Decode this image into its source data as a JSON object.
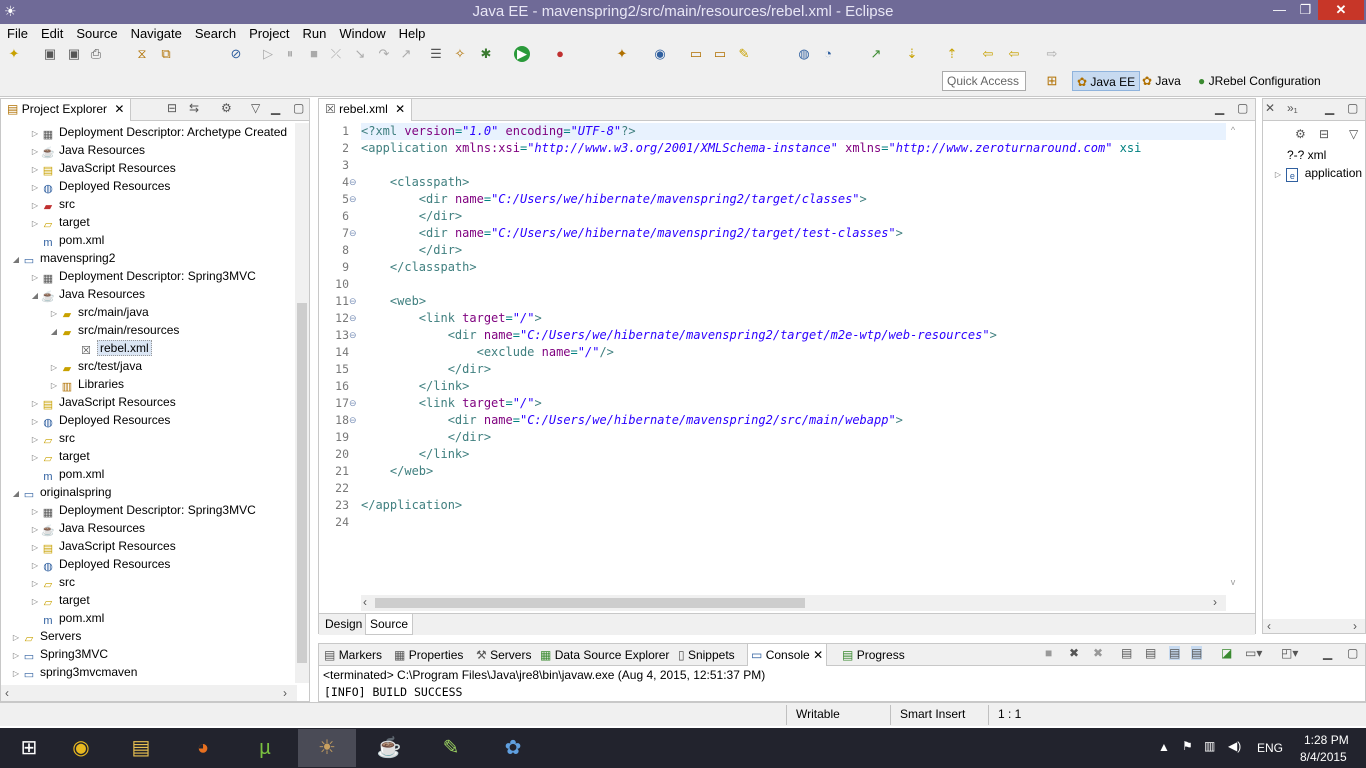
{
  "window": {
    "title": "Java EE - mavenspring2/src/main/resources/rebel.xml - Eclipse"
  },
  "menu": [
    "File",
    "Edit",
    "Source",
    "Navigate",
    "Search",
    "Project",
    "Run",
    "Window",
    "Help"
  ],
  "toolbar": {
    "quick_access_placeholder": "Quick Access",
    "perspectives": [
      "Java EE",
      "Java",
      "JRebel Configuration"
    ]
  },
  "explorer": {
    "tab": "Project Explorer",
    "tree": [
      {
        "label": "Deployment Descriptor: Archetype Created",
        "icon": "descriptor-icon",
        "indent": 1,
        "toggle": "closed"
      },
      {
        "label": "Java Resources",
        "icon": "java-resources-icon",
        "indent": 1,
        "toggle": "closed"
      },
      {
        "label": "JavaScript Resources",
        "icon": "js-resources-icon",
        "indent": 1,
        "toggle": "closed"
      },
      {
        "label": "Deployed Resources",
        "icon": "deployed-icon",
        "indent": 1,
        "toggle": "closed"
      },
      {
        "label": "src",
        "icon": "folder-src-icon",
        "indent": 1,
        "toggle": "closed"
      },
      {
        "label": "target",
        "icon": "folder-icon",
        "indent": 1,
        "toggle": "closed"
      },
      {
        "label": "pom.xml",
        "icon": "maven-file-icon",
        "indent": 1,
        "toggle": "none"
      },
      {
        "label": "mavenspring2",
        "icon": "maven-project-icon",
        "indent": 0,
        "toggle": "open"
      },
      {
        "label": "Deployment Descriptor: Spring3MVC",
        "icon": "descriptor-icon",
        "indent": 1,
        "toggle": "closed"
      },
      {
        "label": "Java Resources",
        "icon": "java-resources-icon",
        "indent": 1,
        "toggle": "open"
      },
      {
        "label": "src/main/java",
        "icon": "package-folder-icon",
        "indent": 2,
        "toggle": "closed"
      },
      {
        "label": "src/main/resources",
        "icon": "package-folder-icon",
        "indent": 2,
        "toggle": "open"
      },
      {
        "label": "rebel.xml",
        "icon": "xml-file-icon",
        "indent": 3,
        "toggle": "none",
        "selected": true
      },
      {
        "label": "src/test/java",
        "icon": "package-folder-icon",
        "indent": 2,
        "toggle": "closed"
      },
      {
        "label": "Libraries",
        "icon": "libraries-icon",
        "indent": 2,
        "toggle": "closed"
      },
      {
        "label": "JavaScript Resources",
        "icon": "js-resources-icon",
        "indent": 1,
        "toggle": "closed"
      },
      {
        "label": "Deployed Resources",
        "icon": "deployed-icon",
        "indent": 1,
        "toggle": "closed"
      },
      {
        "label": "src",
        "icon": "folder-icon",
        "indent": 1,
        "toggle": "closed"
      },
      {
        "label": "target",
        "icon": "folder-icon",
        "indent": 1,
        "toggle": "closed"
      },
      {
        "label": "pom.xml",
        "icon": "maven-file-icon",
        "indent": 1,
        "toggle": "none"
      },
      {
        "label": "originalspring",
        "icon": "maven-project-icon",
        "indent": 0,
        "toggle": "open"
      },
      {
        "label": "Deployment Descriptor: Spring3MVC",
        "icon": "descriptor-icon",
        "indent": 1,
        "toggle": "closed"
      },
      {
        "label": "Java Resources",
        "icon": "java-resources-icon",
        "indent": 1,
        "toggle": "closed"
      },
      {
        "label": "JavaScript Resources",
        "icon": "js-resources-icon",
        "indent": 1,
        "toggle": "closed"
      },
      {
        "label": "Deployed Resources",
        "icon": "deployed-icon",
        "indent": 1,
        "toggle": "closed"
      },
      {
        "label": "src",
        "icon": "folder-icon",
        "indent": 1,
        "toggle": "closed"
      },
      {
        "label": "target",
        "icon": "folder-icon",
        "indent": 1,
        "toggle": "closed"
      },
      {
        "label": "pom.xml",
        "icon": "maven-file-icon",
        "indent": 1,
        "toggle": "none"
      },
      {
        "label": "Servers",
        "icon": "folder-icon",
        "indent": 0,
        "toggle": "closed"
      },
      {
        "label": "Spring3MVC",
        "icon": "project-icon",
        "indent": 0,
        "toggle": "closed"
      },
      {
        "label": "spring3mvcmaven",
        "icon": "maven-project-icon",
        "indent": 0,
        "toggle": "closed"
      }
    ]
  },
  "editor": {
    "tab": "rebel.xml",
    "lines": [
      "<?xml version=\"1.0\" encoding=\"UTF-8\"?>",
      "<application xmlns:xsi=\"http://www.w3.org/2001/XMLSchema-instance\" xmlns=\"http://www.zeroturnaround.com\" xsi",
      "",
      "    <classpath>",
      "        <dir name=\"C:/Users/we/hibernate/mavenspring2/target/classes\">",
      "        </dir>",
      "        <dir name=\"C:/Users/we/hibernate/mavenspring2/target/test-classes\">",
      "        </dir>",
      "    </classpath>",
      "",
      "    <web>",
      "        <link target=\"/\">",
      "            <dir name=\"C:/Users/we/hibernate/mavenspring2/target/m2e-wtp/web-resources\">",
      "                <exclude name=\"/\"/>",
      "            </dir>",
      "        </link>",
      "        <link target=\"/\">",
      "            <dir name=\"C:/Users/we/hibernate/mavenspring2/src/main/webapp\">",
      "            </dir>",
      "        </link>",
      "    </web>",
      "",
      "</application>",
      ""
    ],
    "fold_lines": [
      4,
      5,
      7,
      11,
      12,
      13,
      17,
      18
    ],
    "bottom_tabs": [
      "Design",
      "Source"
    ]
  },
  "outline": {
    "items": [
      "?-? xml",
      "application"
    ]
  },
  "console": {
    "tabs": [
      "Markers",
      "Properties",
      "Servers",
      "Data Source Explorer",
      "Snippets",
      "Console",
      "Progress"
    ],
    "terminated": "<terminated> C:\\Program Files\\Java\\jre8\\bin\\javaw.exe (Aug 4, 2015, 12:51:37 PM)",
    "output": "[INFO] BUILD SUCCESS"
  },
  "statusbar": {
    "writable": "Writable",
    "insert_mode": "Smart Insert",
    "position": "1 : 1"
  },
  "taskbar": {
    "apps": [
      "windows-start-icon",
      "chrome-icon",
      "file-explorer-icon",
      "firefox-icon",
      "utorrent-icon",
      "eclipse-javaee-icon",
      "java-icon",
      "notepadpp-icon",
      "paint-icon"
    ],
    "language": "ENG",
    "time": "1:28 PM",
    "date": "8/4/2015"
  }
}
